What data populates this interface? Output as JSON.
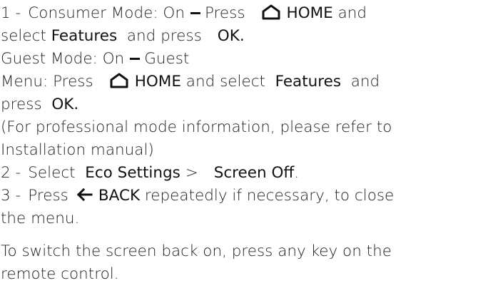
{
  "steps": {
    "s1_num": "1 -",
    "s1_mode": "Consumer Mode: On",
    "s1_press": "Press",
    "home_label": "HOME",
    "s1_and": "and",
    "s1_select": "select",
    "features": "Features",
    "s1_and_press": "and press",
    "ok": "OK",
    "ok_period": "OK.",
    "guest_mode": "Guest Mode: On",
    "guest": "Guest",
    "menu_press": "Menu: Press",
    "and_select": "and select",
    "and": "and",
    "press": "press",
    "prof_line1": "(For professional mode information, please refer to",
    "prof_line2": "Installation manual)",
    "s2_num": "2 -",
    "s2_select": "Select",
    "eco_settings": "Eco Settings",
    "gt": ">",
    "screen_off": "Screen Off",
    "period": ".",
    "s3_num": "3 -",
    "s3_press": "Press",
    "back_label": "BACK",
    "s3_rest": "repeatedly if necessary, to close",
    "s3_line2": "the menu."
  },
  "footer": {
    "line1": "To switch the screen back on, press any key on the",
    "line2": "remote control."
  },
  "icons": {
    "home": "home-icon",
    "back": "back-arrow-icon"
  }
}
